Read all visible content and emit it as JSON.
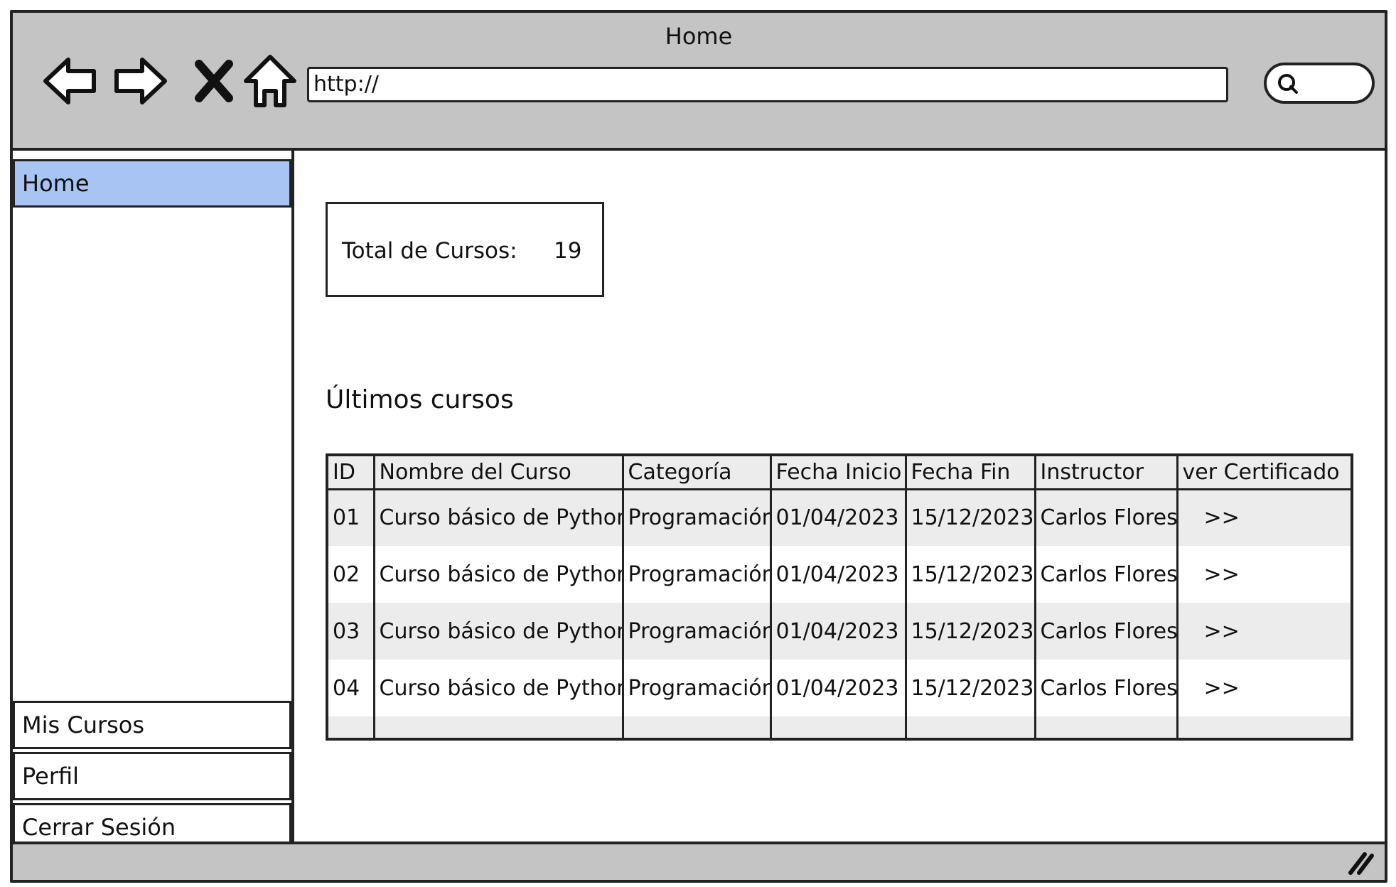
{
  "window": {
    "title": "Home"
  },
  "toolbar": {
    "url": "http://",
    "back_icon": "arrow-left-icon",
    "forward_icon": "arrow-right-icon",
    "stop_icon": "close-icon",
    "home_icon": "home-icon",
    "search_icon": "search-icon"
  },
  "sidebar": {
    "active_item": "Home",
    "items": [
      "Mis Cursos",
      "Perfil",
      "Cerrar Sesión"
    ]
  },
  "main": {
    "total_label": "Total de Cursos:",
    "total_value": "19",
    "section_title": "Últimos cursos",
    "table": {
      "columns": [
        "ID",
        "Nombre del Curso",
        "Categoría",
        "Fecha Inicio",
        "Fecha Fin",
        "Instructor",
        "ver Certificado"
      ],
      "rows": [
        [
          "01",
          "Curso básico de Python",
          "Programación",
          "01/04/2023",
          "15/12/2023",
          "Carlos Flores",
          ">>"
        ],
        [
          "02",
          "Curso básico de Python",
          "Programación",
          "01/04/2023",
          "15/12/2023",
          "Carlos Flores",
          ">>"
        ],
        [
          "03",
          "Curso básico de Python",
          "Programación",
          "01/04/2023",
          "15/12/2023",
          "Carlos Flores",
          ">>"
        ],
        [
          "04",
          "Curso básico de Python",
          "Programación",
          "01/04/2023",
          "15/12/2023",
          "Carlos Flores",
          ">>"
        ]
      ]
    }
  },
  "colors": {
    "chrome": "#c4c4c4",
    "active_nav": "#a7c4f2",
    "row_alt": "#ececec"
  }
}
